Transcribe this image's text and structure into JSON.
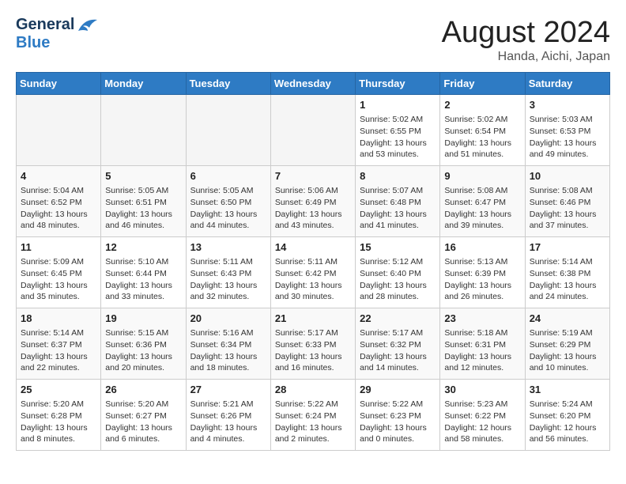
{
  "header": {
    "logo_general": "General",
    "logo_blue": "Blue",
    "month_title": "August 2024",
    "location": "Handa, Aichi, Japan"
  },
  "weekdays": [
    "Sunday",
    "Monday",
    "Tuesday",
    "Wednesday",
    "Thursday",
    "Friday",
    "Saturday"
  ],
  "weeks": [
    {
      "days": [
        {
          "num": "",
          "info": ""
        },
        {
          "num": "",
          "info": ""
        },
        {
          "num": "",
          "info": ""
        },
        {
          "num": "",
          "info": ""
        },
        {
          "num": "1",
          "info": "Sunrise: 5:02 AM\nSunset: 6:55 PM\nDaylight: 13 hours\nand 53 minutes."
        },
        {
          "num": "2",
          "info": "Sunrise: 5:02 AM\nSunset: 6:54 PM\nDaylight: 13 hours\nand 51 minutes."
        },
        {
          "num": "3",
          "info": "Sunrise: 5:03 AM\nSunset: 6:53 PM\nDaylight: 13 hours\nand 49 minutes."
        }
      ]
    },
    {
      "days": [
        {
          "num": "4",
          "info": "Sunrise: 5:04 AM\nSunset: 6:52 PM\nDaylight: 13 hours\nand 48 minutes."
        },
        {
          "num": "5",
          "info": "Sunrise: 5:05 AM\nSunset: 6:51 PM\nDaylight: 13 hours\nand 46 minutes."
        },
        {
          "num": "6",
          "info": "Sunrise: 5:05 AM\nSunset: 6:50 PM\nDaylight: 13 hours\nand 44 minutes."
        },
        {
          "num": "7",
          "info": "Sunrise: 5:06 AM\nSunset: 6:49 PM\nDaylight: 13 hours\nand 43 minutes."
        },
        {
          "num": "8",
          "info": "Sunrise: 5:07 AM\nSunset: 6:48 PM\nDaylight: 13 hours\nand 41 minutes."
        },
        {
          "num": "9",
          "info": "Sunrise: 5:08 AM\nSunset: 6:47 PM\nDaylight: 13 hours\nand 39 minutes."
        },
        {
          "num": "10",
          "info": "Sunrise: 5:08 AM\nSunset: 6:46 PM\nDaylight: 13 hours\nand 37 minutes."
        }
      ]
    },
    {
      "days": [
        {
          "num": "11",
          "info": "Sunrise: 5:09 AM\nSunset: 6:45 PM\nDaylight: 13 hours\nand 35 minutes."
        },
        {
          "num": "12",
          "info": "Sunrise: 5:10 AM\nSunset: 6:44 PM\nDaylight: 13 hours\nand 33 minutes."
        },
        {
          "num": "13",
          "info": "Sunrise: 5:11 AM\nSunset: 6:43 PM\nDaylight: 13 hours\nand 32 minutes."
        },
        {
          "num": "14",
          "info": "Sunrise: 5:11 AM\nSunset: 6:42 PM\nDaylight: 13 hours\nand 30 minutes."
        },
        {
          "num": "15",
          "info": "Sunrise: 5:12 AM\nSunset: 6:40 PM\nDaylight: 13 hours\nand 28 minutes."
        },
        {
          "num": "16",
          "info": "Sunrise: 5:13 AM\nSunset: 6:39 PM\nDaylight: 13 hours\nand 26 minutes."
        },
        {
          "num": "17",
          "info": "Sunrise: 5:14 AM\nSunset: 6:38 PM\nDaylight: 13 hours\nand 24 minutes."
        }
      ]
    },
    {
      "days": [
        {
          "num": "18",
          "info": "Sunrise: 5:14 AM\nSunset: 6:37 PM\nDaylight: 13 hours\nand 22 minutes."
        },
        {
          "num": "19",
          "info": "Sunrise: 5:15 AM\nSunset: 6:36 PM\nDaylight: 13 hours\nand 20 minutes."
        },
        {
          "num": "20",
          "info": "Sunrise: 5:16 AM\nSunset: 6:34 PM\nDaylight: 13 hours\nand 18 minutes."
        },
        {
          "num": "21",
          "info": "Sunrise: 5:17 AM\nSunset: 6:33 PM\nDaylight: 13 hours\nand 16 minutes."
        },
        {
          "num": "22",
          "info": "Sunrise: 5:17 AM\nSunset: 6:32 PM\nDaylight: 13 hours\nand 14 minutes."
        },
        {
          "num": "23",
          "info": "Sunrise: 5:18 AM\nSunset: 6:31 PM\nDaylight: 13 hours\nand 12 minutes."
        },
        {
          "num": "24",
          "info": "Sunrise: 5:19 AM\nSunset: 6:29 PM\nDaylight: 13 hours\nand 10 minutes."
        }
      ]
    },
    {
      "days": [
        {
          "num": "25",
          "info": "Sunrise: 5:20 AM\nSunset: 6:28 PM\nDaylight: 13 hours\nand 8 minutes."
        },
        {
          "num": "26",
          "info": "Sunrise: 5:20 AM\nSunset: 6:27 PM\nDaylight: 13 hours\nand 6 minutes."
        },
        {
          "num": "27",
          "info": "Sunrise: 5:21 AM\nSunset: 6:26 PM\nDaylight: 13 hours\nand 4 minutes."
        },
        {
          "num": "28",
          "info": "Sunrise: 5:22 AM\nSunset: 6:24 PM\nDaylight: 13 hours\nand 2 minutes."
        },
        {
          "num": "29",
          "info": "Sunrise: 5:22 AM\nSunset: 6:23 PM\nDaylight: 13 hours\nand 0 minutes."
        },
        {
          "num": "30",
          "info": "Sunrise: 5:23 AM\nSunset: 6:22 PM\nDaylight: 12 hours\nand 58 minutes."
        },
        {
          "num": "31",
          "info": "Sunrise: 5:24 AM\nSunset: 6:20 PM\nDaylight: 12 hours\nand 56 minutes."
        }
      ]
    }
  ]
}
